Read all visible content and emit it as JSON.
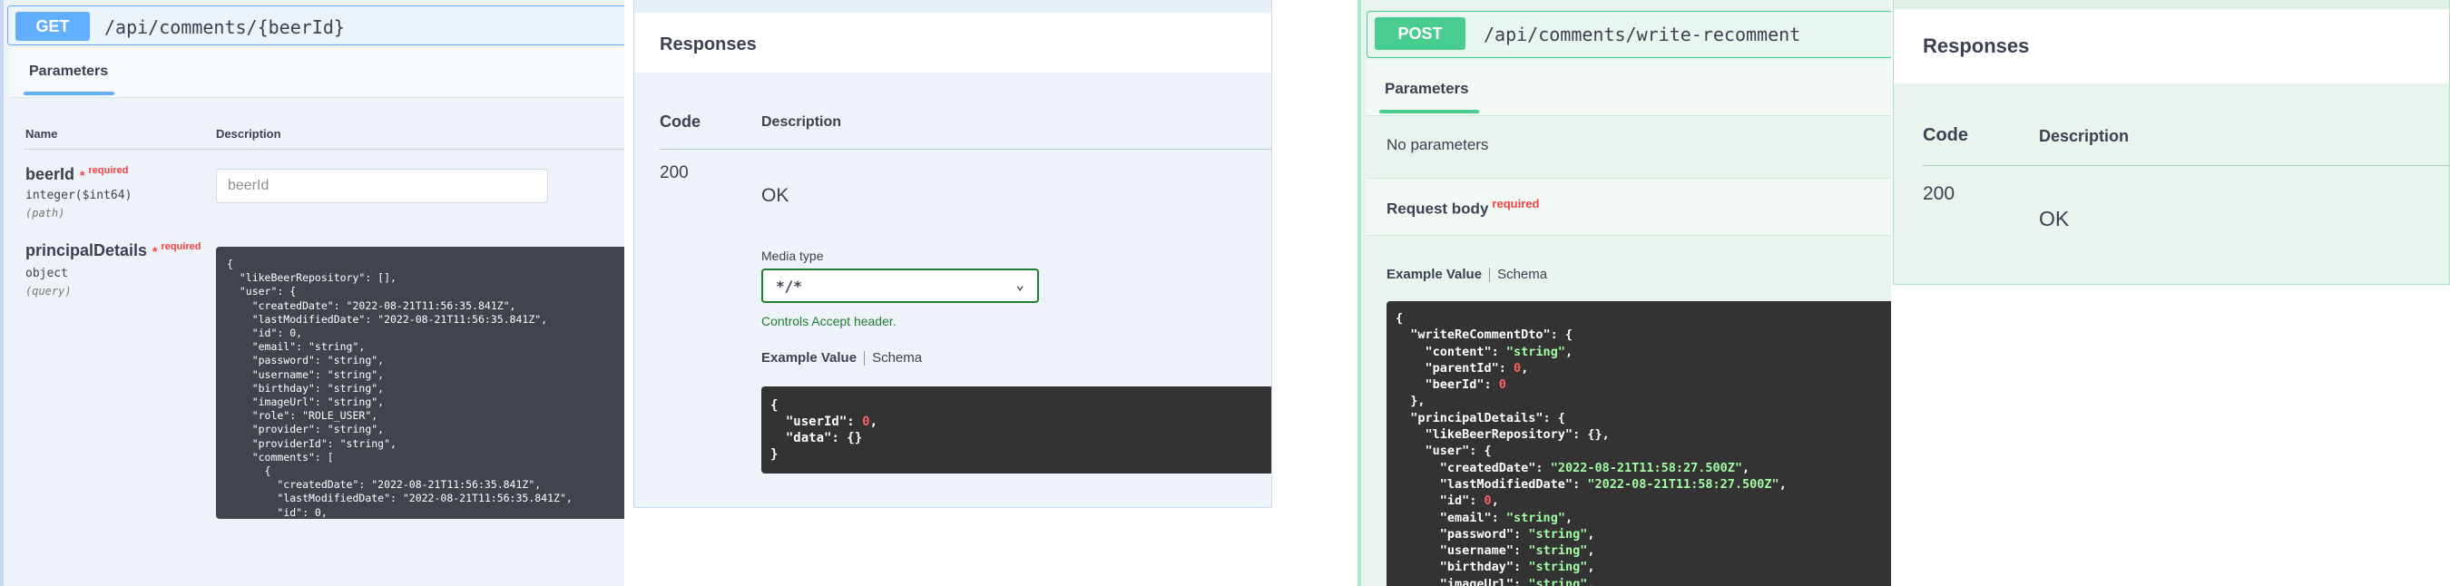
{
  "get_op": {
    "method": "GET",
    "path": "/api/comments/{beerId}",
    "tab_parameters": "Parameters",
    "col_name": "Name",
    "col_description": "Description",
    "params": [
      {
        "name": "beerId",
        "star": "*",
        "required": "required",
        "type": "integer($int64)",
        "in": "(path)",
        "placeholder": "beerId"
      },
      {
        "name": "principalDetails",
        "star": "*",
        "required": "required",
        "type": "object",
        "in": "(query)"
      }
    ],
    "principal_example": "{\n  \"likeBeerRepository\": [],\n  \"user\": {\n    \"createdDate\": \"2022-08-21T11:56:35.841Z\",\n    \"lastModifiedDate\": \"2022-08-21T11:56:35.841Z\",\n    \"id\": 0,\n    \"email\": \"string\",\n    \"password\": \"string\",\n    \"username\": \"string\",\n    \"birthday\": \"string\",\n    \"imageUrl\": \"string\",\n    \"role\": \"ROLE_USER\",\n    \"provider\": \"string\",\n    \"providerId\": \"string\",\n    \"comments\": [\n      {\n        \"createdDate\": \"2022-08-21T11:56:35.841Z\",\n        \"lastModifiedDate\": \"2022-08-21T11:56:35.841Z\",\n        \"id\": 0,\n        \"content\": \"string\","
  },
  "get_responses": {
    "title": "Responses",
    "col_code": "Code",
    "col_description": "Description",
    "code": "200",
    "description": "OK",
    "media_type_label": "Media type",
    "media_type_value": "*/*",
    "controls_text": "Controls Accept header.",
    "example_value": "Example Value",
    "schema": "Schema",
    "example": {
      "open": "{",
      "userId_key": "\"userId\"",
      "userId_val": "0",
      "data_key": "\"data\"",
      "data_val": "{}",
      "close": "}"
    }
  },
  "post_op": {
    "method": "POST",
    "path": "/api/comments/write-recomment",
    "tab_parameters": "Parameters",
    "no_params": "No parameters",
    "request_body": "Request body",
    "required": "required",
    "example_value": "Example Value",
    "schema": "Schema",
    "created_date": "2022-08-21T11:58:27.500Z",
    "modified_date": "2022-08-21T11:58:27.500Z"
  },
  "post_responses": {
    "title": "Responses",
    "col_code": "Code",
    "col_description": "Description",
    "code": "200",
    "description": "OK"
  },
  "colors": {
    "get": "#61affe",
    "post": "#49cc90",
    "required": "#f93e3e",
    "accept_green": "#1e7f30"
  }
}
